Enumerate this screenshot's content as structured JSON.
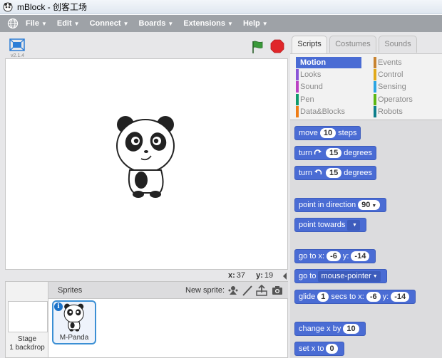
{
  "window": {
    "title": "mBlock - 创客工场"
  },
  "menubar": {
    "items": [
      {
        "label": "File"
      },
      {
        "label": "Edit"
      },
      {
        "label": "Connect"
      },
      {
        "label": "Boards"
      },
      {
        "label": "Extensions"
      },
      {
        "label": "Help"
      }
    ]
  },
  "stage": {
    "version": "v2.1.4",
    "mouse_x_label": "x:",
    "mouse_x": "37",
    "mouse_y_label": "y:",
    "mouse_y": "19"
  },
  "sprites": {
    "header": "Sprites",
    "new_sprite_label": "New sprite:",
    "stage_name": "Stage",
    "stage_backdrops": "1 backdrop",
    "items": [
      {
        "name": "M-Panda"
      }
    ]
  },
  "tabs": [
    {
      "label": "Scripts",
      "active": true
    },
    {
      "label": "Costumes",
      "active": false
    },
    {
      "label": "Sounds",
      "active": false
    }
  ],
  "categories": [
    {
      "label": "Motion",
      "color": "#4a6cd4",
      "selected": true
    },
    {
      "label": "Events",
      "color": "#c88330",
      "selected": false
    },
    {
      "label": "Looks",
      "color": "#8a55d7",
      "selected": false
    },
    {
      "label": "Control",
      "color": "#e1a91a",
      "selected": false
    },
    {
      "label": "Sound",
      "color": "#bb42c3",
      "selected": false
    },
    {
      "label": "Sensing",
      "color": "#2ca5e2",
      "selected": false
    },
    {
      "label": "Pen",
      "color": "#0e9a6c",
      "selected": false
    },
    {
      "label": "Operators",
      "color": "#5cb712",
      "selected": false
    },
    {
      "label": "Data&Blocks",
      "color": "#ee7d16",
      "selected": false
    },
    {
      "label": "Robots",
      "color": "#0d7f8c",
      "selected": false
    }
  ],
  "blocks": {
    "move": {
      "pre": "move",
      "value": "10",
      "post": "steps"
    },
    "turn_right": {
      "pre": "turn",
      "value": "15",
      "post": "degrees"
    },
    "turn_left": {
      "pre": "turn",
      "value": "15",
      "post": "degrees"
    },
    "point_direction": {
      "pre": "point in direction",
      "value": "90"
    },
    "point_towards": {
      "pre": "point towards"
    },
    "go_to_xy": {
      "pre": "go to x:",
      "x": "-6",
      "mid": "y:",
      "y": "-14"
    },
    "go_to": {
      "pre": "go to",
      "value": "mouse-pointer"
    },
    "glide": {
      "pre": "glide",
      "secs": "1",
      "mid1": "secs to x:",
      "x": "-6",
      "mid2": "y:",
      "y": "-14"
    },
    "change_x": {
      "pre": "change x by",
      "value": "10"
    },
    "set_x": {
      "pre": "set x to",
      "value": "0"
    }
  },
  "colors": {
    "motion": "#4a6cd4",
    "menubar": "#9ea2a7",
    "stop": "#e0262a",
    "flag": "#2e8b2e"
  },
  "icons": {
    "fullscreen": "fullscreen-icon",
    "green_flag": "green-flag-icon",
    "stop": "stop-sign-icon",
    "globe": "globe-icon",
    "paint_sprite": "paintbrush-icon",
    "library_sprite": "sprite-library-icon",
    "upload_sprite": "upload-icon",
    "camera_sprite": "camera-icon"
  }
}
